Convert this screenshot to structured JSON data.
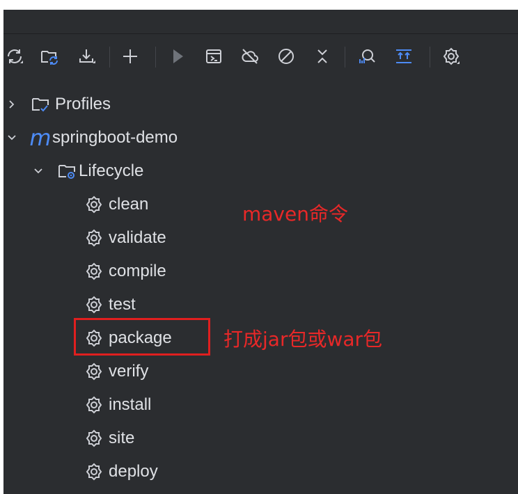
{
  "colors": {
    "panel_bg": "#2b2d30",
    "text": "#dfe1e5",
    "icon": "#ced0d6",
    "maven_accent": "#4d8bf5",
    "annotation": "#e82828"
  },
  "toolbar": {
    "buttons": [
      {
        "icon": "reload-all-projects-icon"
      },
      {
        "icon": "reimport-icon"
      },
      {
        "icon": "download-sources-icon"
      },
      {
        "icon": "add-maven-project-icon"
      },
      {
        "icon": "run-maven-build-icon"
      },
      {
        "icon": "execute-goal-icon"
      },
      {
        "icon": "toggle-offline-icon"
      },
      {
        "icon": "skip-tests-icon"
      },
      {
        "icon": "collapse-all-icon"
      },
      {
        "icon": "analyze-dependencies-icon"
      },
      {
        "icon": "show-dependencies-icon"
      },
      {
        "icon": "settings-icon"
      }
    ]
  },
  "tree": {
    "profiles": "Profiles",
    "project": "springboot-demo",
    "project_mark": "m",
    "lifecycle": "Lifecycle",
    "goals": [
      "clean",
      "validate",
      "compile",
      "test",
      "package",
      "verify",
      "install",
      "site",
      "deploy"
    ]
  },
  "annotations": {
    "maven": "maven命令",
    "package": "打成jar包或war包"
  }
}
